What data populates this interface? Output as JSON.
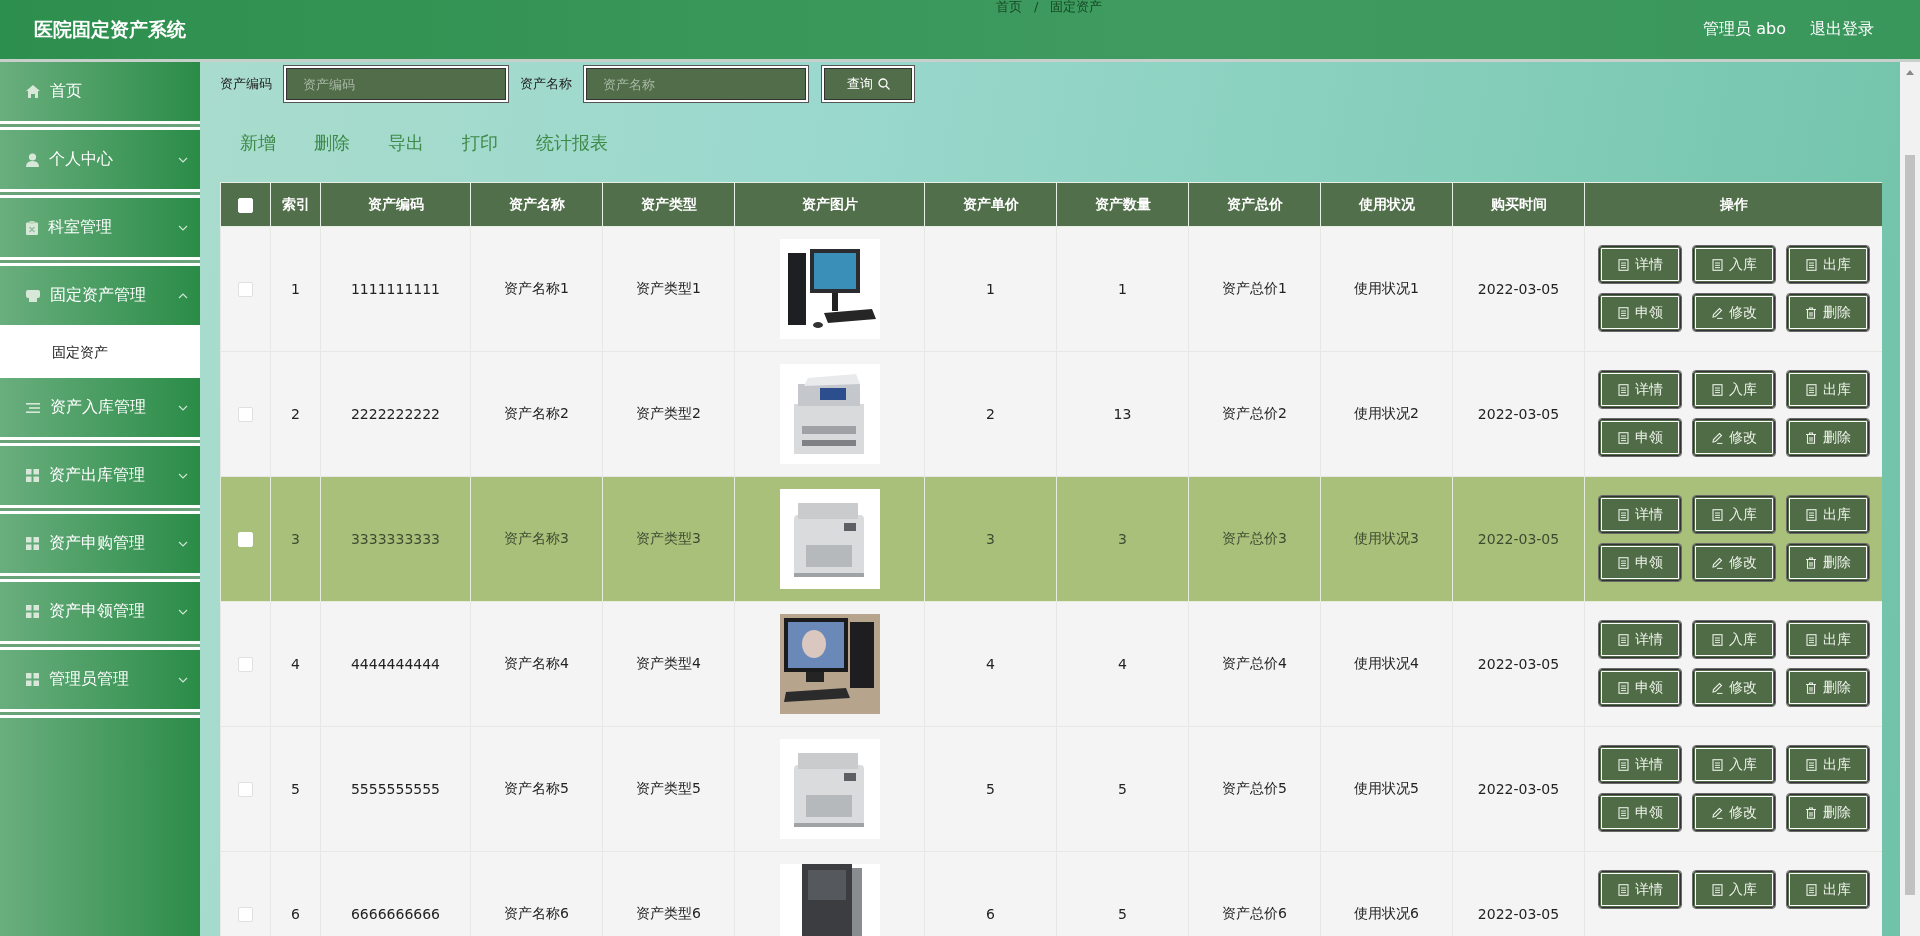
{
  "header": {
    "title": "医院固定资产系统",
    "breadcrumb": [
      "首页",
      "固定资产"
    ],
    "breadcrumb_separator": "/",
    "user": "管理员 abo",
    "logout": "退出登录"
  },
  "sidebar": {
    "items": [
      {
        "label": "首页",
        "expandable": false
      },
      {
        "label": "个人中心",
        "expandable": true,
        "expanded": false
      },
      {
        "label": "科室管理",
        "expandable": true,
        "expanded": false
      },
      {
        "label": "固定资产管理",
        "expandable": true,
        "expanded": true,
        "children": [
          {
            "label": "固定资产"
          }
        ]
      },
      {
        "label": "资产入库管理",
        "expandable": true,
        "expanded": false
      },
      {
        "label": "资产出库管理",
        "expandable": true,
        "expanded": false
      },
      {
        "label": "资产申购管理",
        "expandable": true,
        "expanded": false
      },
      {
        "label": "资产申领管理",
        "expandable": true,
        "expanded": false
      },
      {
        "label": "管理员管理",
        "expandable": true,
        "expanded": false
      }
    ]
  },
  "search": {
    "fields": [
      {
        "label": "资产编码",
        "placeholder": "资产编码"
      },
      {
        "label": "资产名称",
        "placeholder": "资产名称"
      }
    ],
    "button": "查询"
  },
  "actions": [
    "新增",
    "删除",
    "导出",
    "打印",
    "统计报表"
  ],
  "table": {
    "columns": [
      "索引",
      "资产编码",
      "资产名称",
      "资产类型",
      "资产图片",
      "资产单价",
      "资产数量",
      "资产总价",
      "使用状况",
      "购买时间",
      "操作"
    ],
    "header_checked": false,
    "rows": [
      {
        "checked": false,
        "highlighted": false,
        "cells": [
          "1",
          "1111111111",
          "资产名称1",
          "资产类型1",
          "",
          "1",
          "1",
          "资产总价1",
          "使用状况1",
          "2022-03-05"
        ],
        "buttons": [
          {
            "label": "详情",
            "kind": "doc"
          },
          {
            "label": "入库",
            "kind": "doc"
          },
          {
            "label": "出库",
            "kind": "doc"
          },
          {
            "label": "申领",
            "kind": "doc"
          },
          {
            "label": "修改",
            "kind": "edit"
          },
          {
            "label": "删除",
            "kind": "delete"
          }
        ]
      },
      {
        "checked": false,
        "highlighted": false,
        "cells": [
          "2",
          "2222222222",
          "资产名称2",
          "资产类型2",
          "",
          "2",
          "13",
          "资产总价2",
          "使用状况2",
          "2022-03-05"
        ],
        "buttons": [
          {
            "label": "详情",
            "kind": "doc"
          },
          {
            "label": "入库",
            "kind": "doc"
          },
          {
            "label": "出库",
            "kind": "doc"
          },
          {
            "label": "申领",
            "kind": "doc"
          },
          {
            "label": "修改",
            "kind": "edit"
          },
          {
            "label": "删除",
            "kind": "delete"
          }
        ]
      },
      {
        "checked": false,
        "highlighted": true,
        "cells": [
          "3",
          "3333333333",
          "资产名称3",
          "资产类型3",
          "",
          "3",
          "3",
          "资产总价3",
          "使用状况3",
          "2022-03-05"
        ],
        "buttons": [
          {
            "label": "详情",
            "kind": "doc"
          },
          {
            "label": "入库",
            "kind": "doc"
          },
          {
            "label": "出库",
            "kind": "doc"
          },
          {
            "label": "申领",
            "kind": "doc"
          },
          {
            "label": "修改",
            "kind": "edit"
          },
          {
            "label": "删除",
            "kind": "delete"
          }
        ]
      },
      {
        "checked": false,
        "highlighted": false,
        "cells": [
          "4",
          "4444444444",
          "资产名称4",
          "资产类型4",
          "",
          "4",
          "4",
          "资产总价4",
          "使用状况4",
          "2022-03-05"
        ],
        "buttons": [
          {
            "label": "详情",
            "kind": "doc"
          },
          {
            "label": "入库",
            "kind": "doc"
          },
          {
            "label": "出库",
            "kind": "doc"
          },
          {
            "label": "申领",
            "kind": "doc"
          },
          {
            "label": "修改",
            "kind": "edit"
          },
          {
            "label": "删除",
            "kind": "delete"
          }
        ]
      },
      {
        "checked": false,
        "highlighted": false,
        "cells": [
          "5",
          "5555555555",
          "资产名称5",
          "资产类型5",
          "",
          "5",
          "5",
          "资产总价5",
          "使用状况5",
          "2022-03-05"
        ],
        "buttons": [
          {
            "label": "详情",
            "kind": "doc"
          },
          {
            "label": "入库",
            "kind": "doc"
          },
          {
            "label": "出库",
            "kind": "doc"
          },
          {
            "label": "申领",
            "kind": "doc"
          },
          {
            "label": "修改",
            "kind": "edit"
          },
          {
            "label": "删除",
            "kind": "delete"
          }
        ]
      },
      {
        "checked": false,
        "highlighted": false,
        "cells": [
          "6",
          "6666666666",
          "资产名称6",
          "资产类型6",
          "",
          "6",
          "5",
          "资产总价6",
          "使用状况6",
          "2022-03-05"
        ],
        "buttons": [
          {
            "label": "详情",
            "kind": "doc"
          },
          {
            "label": "入库",
            "kind": "doc"
          },
          {
            "label": "出库",
            "kind": "doc"
          }
        ]
      }
    ]
  }
}
